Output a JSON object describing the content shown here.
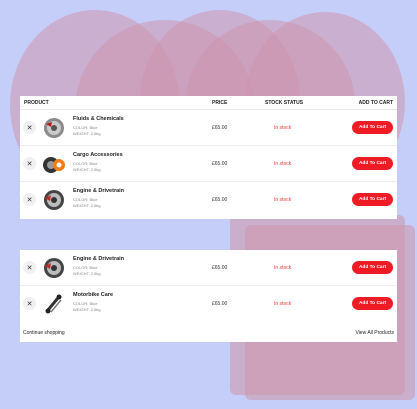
{
  "table": {
    "headers": {
      "product": "PRODUCT",
      "price": "PRICE",
      "stock": "STOCK STATUS",
      "cart": "ADD TO CART"
    },
    "group1": [
      {
        "name": "Fluids & Chemicals",
        "color": "COLOR: Blue",
        "weight": "WEIGHT: 2.5kg",
        "price": "£65.00",
        "stock": "In stock",
        "cart": "Add To Cart",
        "icon": "brake-disc-icon"
      },
      {
        "name": "Cargo Accessories",
        "color": "COLOR: Blue",
        "weight": "WEIGHT: 2.5kg",
        "price": "£65.00",
        "stock": "In stock",
        "cart": "Add To Cart",
        "icon": "wheel-tire-icon"
      },
      {
        "name": "Engine & Drivetrain",
        "color": "COLOR: Blue",
        "weight": "WEIGHT: 2.5kg",
        "price": "£65.00",
        "stock": "In stock",
        "cart": "Add To Cart",
        "icon": "brake-rotor-icon"
      }
    ],
    "group2": [
      {
        "name": "Engine & Drivetrain",
        "color": "COLOR: Blue",
        "weight": "WEIGHT: 2.5kg",
        "price": "£65.00",
        "stock": "In stock",
        "cart": "Add To Cart",
        "icon": "brake-rotor-icon"
      },
      {
        "name": "Motorbike Care",
        "color": "COLOR: Blue",
        "weight": "WEIGHT: 2.5kg",
        "price": "£65.00",
        "stock": "In stock",
        "cart": "Add To Cart",
        "icon": "shock-absorber-icon"
      }
    ],
    "footer": {
      "continue": "Continue shopping",
      "view_all": "View All Products"
    }
  },
  "colors": {
    "background": "#c5cef9",
    "accent": "#ef1c25",
    "stock": "#e53935"
  }
}
